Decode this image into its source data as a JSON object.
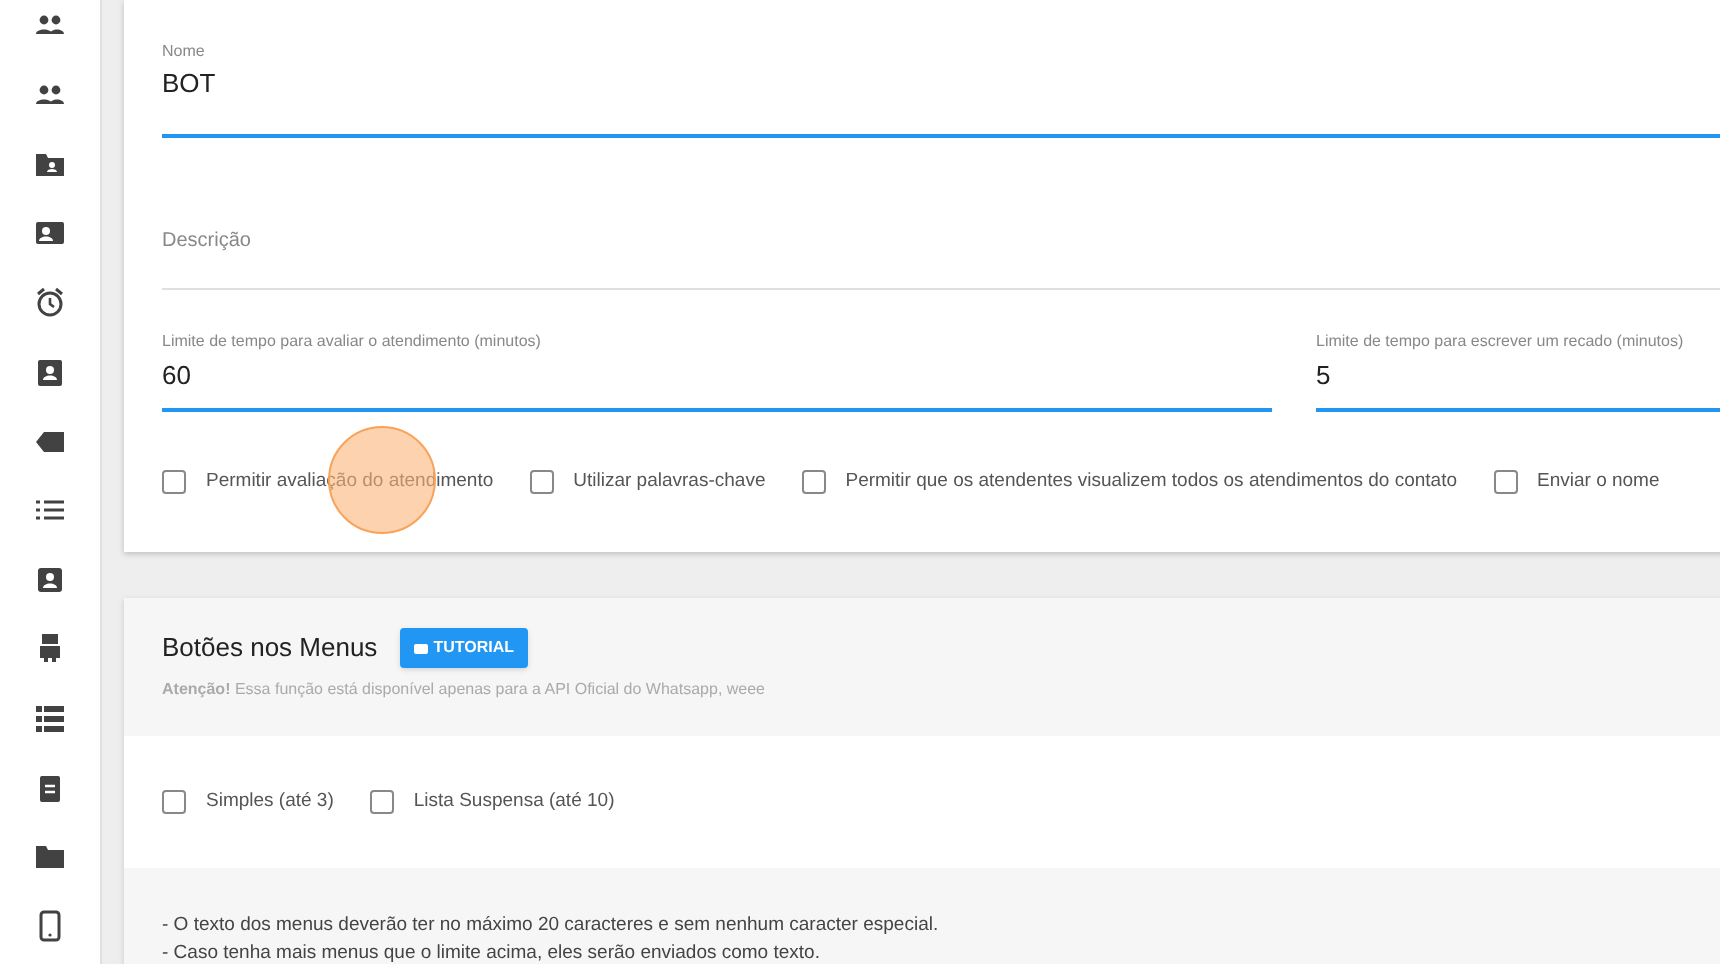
{
  "form": {
    "name": {
      "label": "Nome",
      "value": "BOT"
    },
    "description": {
      "placeholder": "Descrição"
    },
    "limits": [
      {
        "label": "Limite de tempo para avaliar o atendimento (minutos)",
        "value": "60"
      },
      {
        "label": "Limite de tempo para escrever um recado (minutos)",
        "value": "5"
      }
    ],
    "options": [
      {
        "label": "Permitir avaliação do atendimento",
        "checked": false
      },
      {
        "label": "Utilizar palavras-chave",
        "checked": false
      },
      {
        "label": "Permitir que os atendentes visualizem todos os atendimentos do contato",
        "checked": false
      },
      {
        "label": "Enviar o nome",
        "checked": false
      }
    ]
  },
  "menu_buttons": {
    "title": "Botões nos Menus",
    "tutorial_button": "TUTORIAL",
    "notice": "**Atenção!** Essa função está disponível apenas para a API Oficial do Whatsapp, weee",
    "options": [
      {
        "label": "Simples (até 3)",
        "checked": false
      },
      {
        "label": "Lista Suspensa (até 10)",
        "checked": false
      }
    ],
    "notes": [
      "- O texto dos menus deverão ter no máximo 20 caracteres e sem nenhum caracter especial.",
      "- Caso tenha mais menus que o limite acima, eles serão enviados como texto."
    ]
  }
}
